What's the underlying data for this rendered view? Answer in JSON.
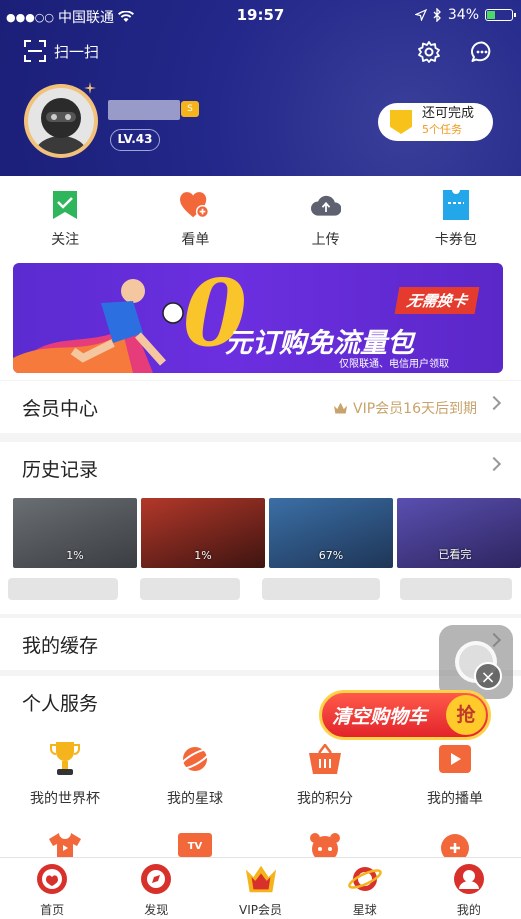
{
  "status_bar": {
    "signal": "●●●○○",
    "carrier": "中国联通",
    "time": "19:57",
    "battery": "34%"
  },
  "header": {
    "scan_label": "扫一扫",
    "level": "LV.43",
    "crown_letter": "S",
    "task": {
      "title": "还可完成",
      "subtitle": "5个任务"
    }
  },
  "quick_actions": [
    {
      "label": "关注",
      "icon": "bookmark-check-icon",
      "color": "#2fb55b"
    },
    {
      "label": "看单",
      "icon": "heart-plus-icon",
      "color": "#f2683a"
    },
    {
      "label": "上传",
      "icon": "cloud-upload-icon",
      "color": "#5e6270"
    },
    {
      "label": "卡券包",
      "icon": "ticket-icon",
      "color": "#23a6ea"
    }
  ],
  "banner": {
    "zero": "0",
    "main": "元订购免流量包",
    "tag": "无需换卡",
    "sub": "仅限联通、电信用户领取"
  },
  "member_center": {
    "title": "会员中心",
    "note": "VIP会员16天后到期"
  },
  "history": {
    "title": "历史记录",
    "items": [
      {
        "progress": "1%",
        "colors": [
          "#6a6f74",
          "#3a3d42"
        ]
      },
      {
        "progress": "1%",
        "colors": [
          "#b3382a",
          "#3d1410"
        ]
      },
      {
        "progress": "67%",
        "colors": [
          "#3b6fa6",
          "#1e3556"
        ]
      },
      {
        "progress": "已看完",
        "colors": [
          "#5a4fb0",
          "#2d2560"
        ]
      }
    ]
  },
  "cache": {
    "title": "我的缓存"
  },
  "services": {
    "title": "个人服务",
    "items": [
      {
        "label": "我的世界杯",
        "icon": "trophy-icon",
        "color": "#f5b41b"
      },
      {
        "label": "我的星球",
        "icon": "planet-icon",
        "color": "#f2683a"
      },
      {
        "label": "我的积分",
        "icon": "basket-icon",
        "color": "#f2683a"
      },
      {
        "label": "我的播单",
        "icon": "playlist-icon",
        "color": "#f2683a"
      }
    ],
    "second_row_icons": [
      {
        "icon": "tshirt-icon",
        "color": "#f2683a"
      },
      {
        "icon": "tv-icon",
        "color": "#f2683a",
        "text": "TV"
      },
      {
        "icon": "face-icon",
        "color": "#f2683a"
      },
      {
        "icon": "gift-icon",
        "color": "#f2683a"
      }
    ]
  },
  "floating": {
    "cart_text": "清空购物车",
    "cart_grab": "抢",
    "close": "×"
  },
  "tabbar": [
    {
      "label": "首页",
      "icon": "home-icon",
      "color": "#d8312b"
    },
    {
      "label": "发现",
      "icon": "discover-icon",
      "color": "#d8312b"
    },
    {
      "label": "VIP会员",
      "icon": "vip-crown-icon",
      "color": "#d8312b"
    },
    {
      "label": "星球",
      "icon": "planet-tab-icon",
      "color": "#d8312b"
    },
    {
      "label": "我的",
      "icon": "profile-icon",
      "color": "#d8312b"
    }
  ]
}
